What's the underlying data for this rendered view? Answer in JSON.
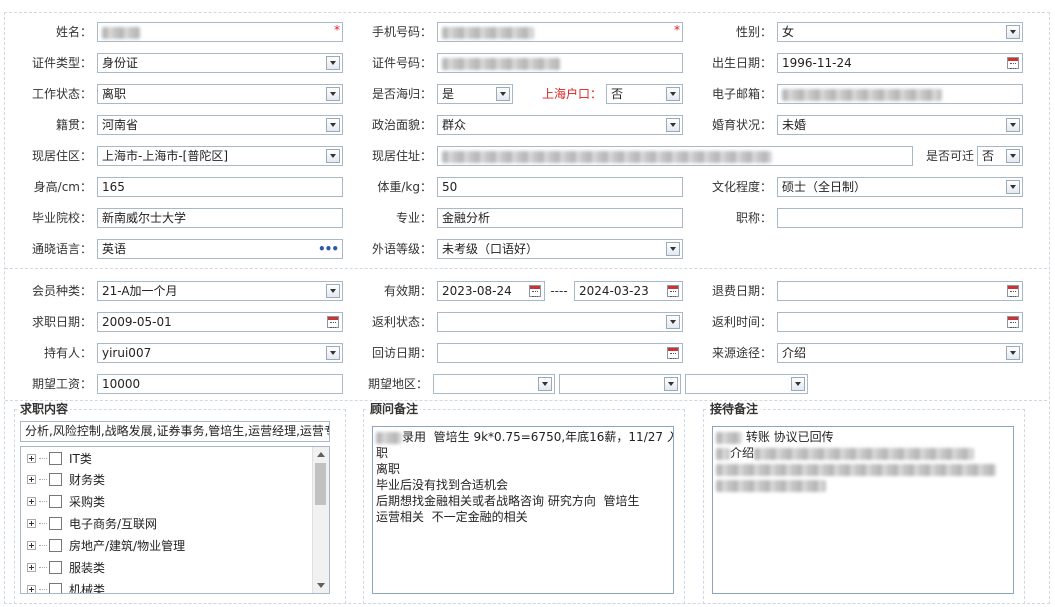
{
  "profile": {
    "name_label": "姓名：",
    "phone_label": "手机号码：",
    "gender_label": "性别：",
    "gender_value": "女",
    "id_type_label": "证件类型：",
    "id_type_value": "身份证",
    "id_number_label": "证件号码：",
    "birth_label": "出生日期：",
    "birth_value": "1996-11-24",
    "work_status_label": "工作状态：",
    "work_status_value": "离职",
    "overseas_label": "是否海归：",
    "overseas_value": "是",
    "hukou_label": "上海户口：",
    "hukou_value": "否",
    "email_label": "电子邮箱：",
    "native_label": "籍贯：",
    "native_value": "河南省",
    "political_label": "政治面貌：",
    "political_value": "群众",
    "marital_label": "婚育状况：",
    "marital_value": "未婚",
    "residence_label": "现居住区：",
    "residence_value": "上海市-上海市-[普陀区]",
    "address_label": "现居住址：",
    "relocate_label": "是否可迁",
    "relocate_value": "否",
    "height_label": "身高/cm：",
    "height_value": "165",
    "weight_label": "体重/kg：",
    "weight_value": "50",
    "education_label": "文化程度：",
    "education_value": "硕士（全日制）",
    "school_label": "毕业院校：",
    "school_value": "新南威尔士大学",
    "major_label": "专业：",
    "major_value": "金融分析",
    "title_label": "职称：",
    "language_label": "通晓语言：",
    "language_value": "英语",
    "foreign_level_label": "外语等级：",
    "foreign_level_value": "未考级（口语好）",
    "required_mark": "*"
  },
  "membership": {
    "type_label": "会员种类：",
    "type_value": "21-A加一个月",
    "validity_label": "有效期：",
    "valid_from": "2023-08-24",
    "range_sep": "----",
    "valid_to": "2024-03-23",
    "refund_date_label": "退费日期：",
    "job_date_label": "求职日期：",
    "job_date_value": "2009-05-01",
    "rebate_status_label": "返利状态：",
    "rebate_time_label": "返利时间：",
    "owner_label": "持有人：",
    "owner_value": "yirui007",
    "visit_date_label": "回访日期：",
    "source_label": "来源途径：",
    "source_value": "介绍",
    "salary_label": "期望工资：",
    "salary_value": "10000",
    "area_label": "期望地区："
  },
  "job_content": {
    "title": "求职内容",
    "summary": "分析,风险控制,战略发展,证券事务,管培生,运营经理,运营专",
    "categories": [
      "IT类",
      "财务类",
      "采购类",
      "电子商务/互联网",
      "房地产/建筑/物业管理",
      "服装类",
      "机械类"
    ]
  },
  "consultant_notes": {
    "title": "顾问备注",
    "lines": [
      "录用  管培生 9k*0.75=6750,年底16薪，11/27 入",
      "职",
      "",
      "离职",
      "毕业后没有找到合适机会",
      "后期想找金融相关或者战略咨询 研究方向  管培生",
      "运营相关  不一定金融的相关"
    ]
  },
  "reception_notes": {
    "title": "接待备注",
    "line1": "转账 协议已回传",
    "line2": "介绍"
  }
}
